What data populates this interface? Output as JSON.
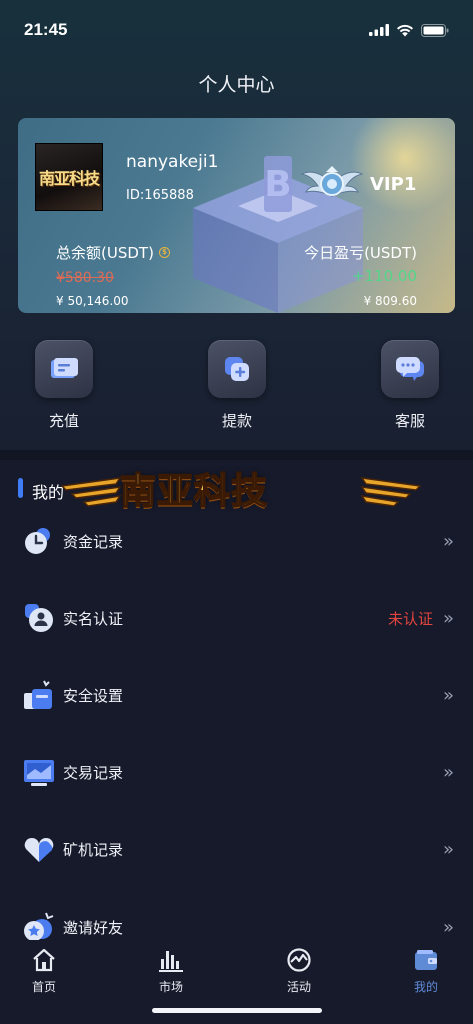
{
  "status_bar": {
    "time": "21:45"
  },
  "header": {
    "title": "个人中心"
  },
  "account": {
    "avatar_text": "南亚科技",
    "username": "nanyakeji1",
    "user_id": "ID:165888",
    "vip_level": "VIP1",
    "balance_label": "总余额(USDT)",
    "balance_value": "¥580.30",
    "balance_cny": "¥ 50,146.00",
    "pnl_label": "今日盈亏(USDT)",
    "pnl_value": "+110.00",
    "pnl_cny": "¥ 809.60"
  },
  "quick_actions": [
    {
      "label": "充值",
      "icon": "deposit-card-icon"
    },
    {
      "label": "提款",
      "icon": "withdraw-icon"
    },
    {
      "label": "客服",
      "icon": "chat-bubble-icon"
    }
  ],
  "section": {
    "title": "我的",
    "banner_text": "南亚科技"
  },
  "menu": [
    {
      "label": "资金记录",
      "status": "",
      "icon": "clock-icon"
    },
    {
      "label": "实名认证",
      "status": "未认证",
      "icon": "user-verify-icon"
    },
    {
      "label": "安全设置",
      "status": "",
      "icon": "shield-settings-icon"
    },
    {
      "label": "交易记录",
      "status": "",
      "icon": "trade-record-icon"
    },
    {
      "label": "矿机记录",
      "status": "",
      "icon": "heart-miner-icon"
    },
    {
      "label": "邀请好友",
      "status": "",
      "icon": "invite-star-icon"
    }
  ],
  "menu_chevron": "»",
  "tabs": [
    {
      "label": "首页",
      "icon": "home-icon"
    },
    {
      "label": "市场",
      "icon": "bar-chart-icon"
    },
    {
      "label": "活动",
      "icon": "activity-icon"
    },
    {
      "label": "我的",
      "icon": "wallet-icon"
    }
  ],
  "colors": {
    "accent": "#3f7cf5",
    "positive": "#54d68a",
    "negative": "#e2453d",
    "active_tab": "#5f8bd6"
  }
}
